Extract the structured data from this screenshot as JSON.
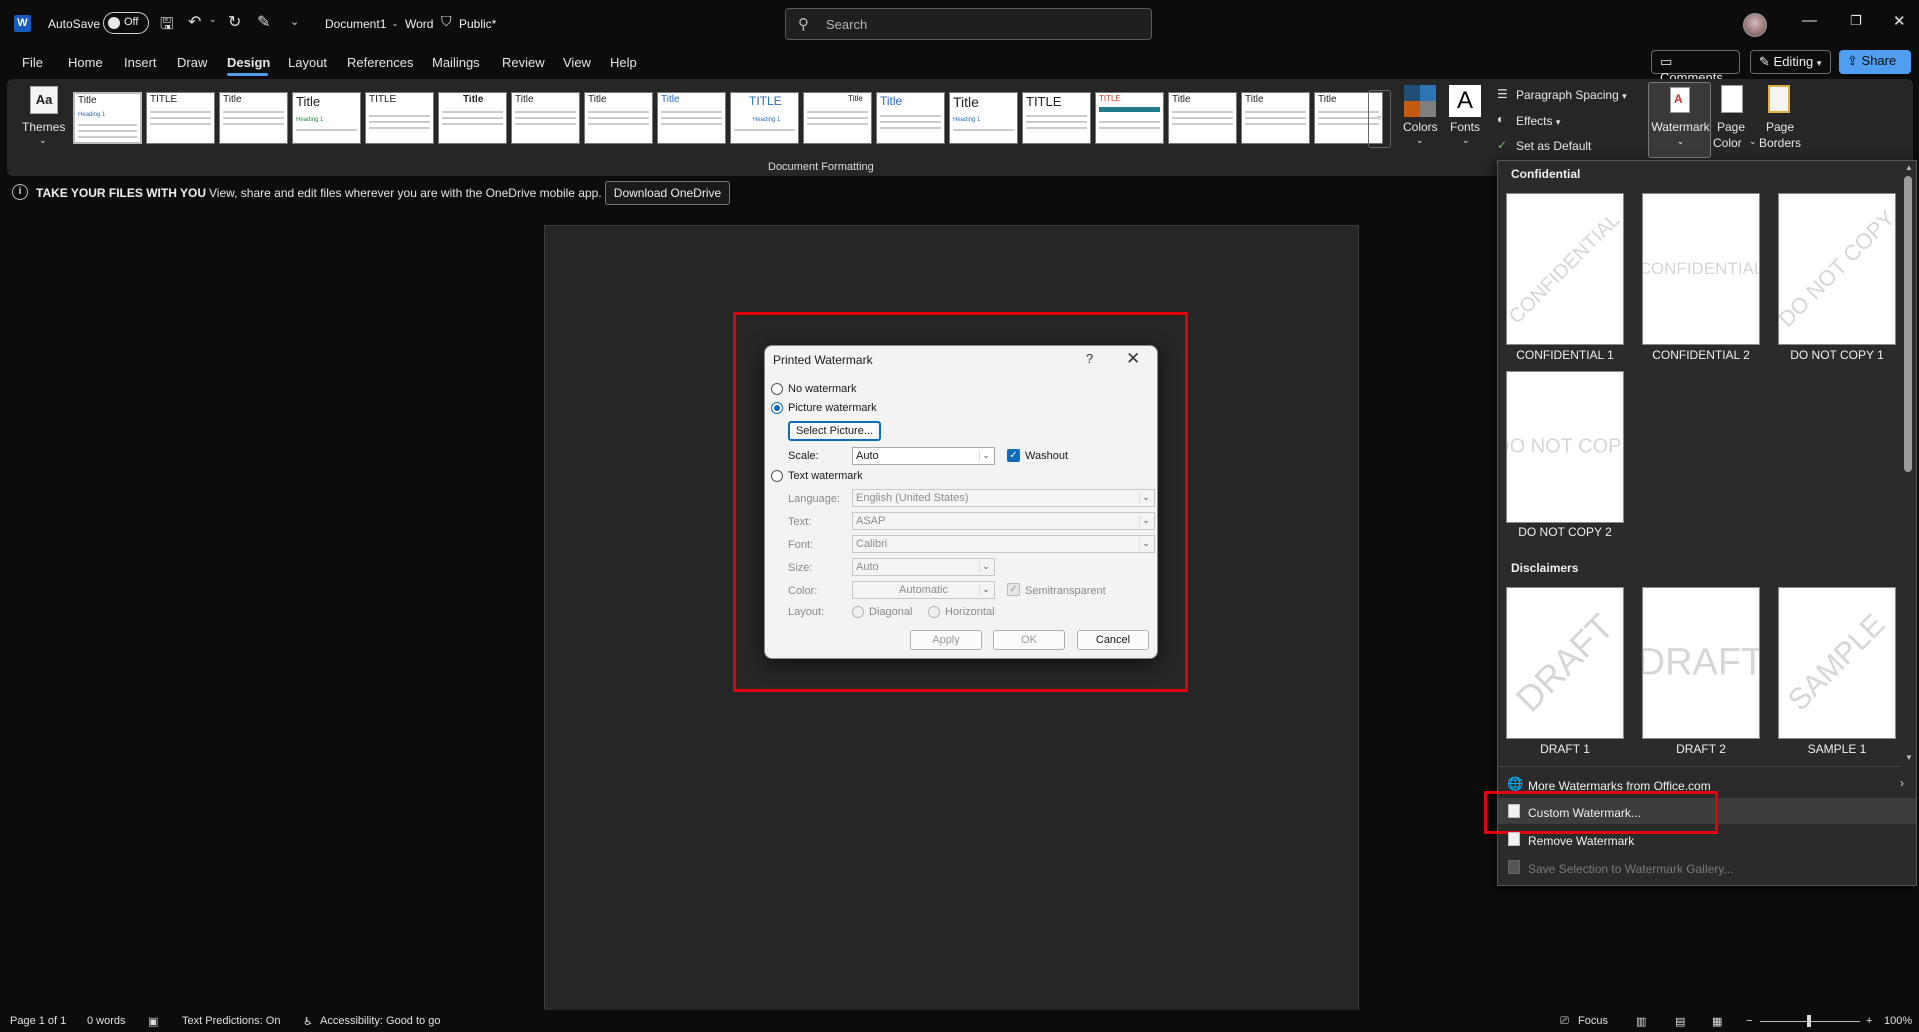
{
  "titlebar": {
    "autosave_label": "AutoSave",
    "autosave_state": "Off",
    "doc_title": "Document1",
    "separator": "-",
    "app_name": "Word",
    "sensitivity": "Public*",
    "search_placeholder": "Search"
  },
  "tabs": [
    {
      "label": "File"
    },
    {
      "label": "Home"
    },
    {
      "label": "Insert"
    },
    {
      "label": "Draw"
    },
    {
      "label": "Design"
    },
    {
      "label": "Layout"
    },
    {
      "label": "References"
    },
    {
      "label": "Mailings"
    },
    {
      "label": "Review"
    },
    {
      "label": "View"
    },
    {
      "label": "Help"
    }
  ],
  "top_actions": {
    "comments": "Comments",
    "editing": "Editing",
    "share": "Share"
  },
  "ribbon": {
    "themes": "Themes",
    "colors": "Colors",
    "fonts": "Fonts",
    "paragraph_spacing": "Paragraph Spacing",
    "effects": "Effects",
    "set_default": "Set as Default",
    "watermark": "Watermark",
    "page_color_1": "Page",
    "page_color_2": "Color",
    "page_borders_1": "Page",
    "page_borders_2": "Borders",
    "group_label": "Document Formatting",
    "gallery": [
      "Title",
      "TITLE",
      "Title",
      "Title",
      "TITLE",
      "Title",
      "Title",
      "Title",
      "Title",
      "TITLE",
      "Title",
      "Title",
      "Title",
      "TITLE",
      "TITLE",
      "Title",
      "Title",
      "Title"
    ]
  },
  "infobar": {
    "heading": "TAKE YOUR FILES WITH YOU",
    "message": "View, share and edit files wherever you are with the OneDrive mobile app.",
    "button": "Download OneDrive"
  },
  "dialog": {
    "title": "Printed Watermark",
    "help": "?",
    "close": "✕",
    "no_watermark": "No watermark",
    "picture_watermark": "Picture watermark",
    "select_picture": "Select Picture...",
    "scale_label": "Scale:",
    "scale_value": "Auto",
    "washout": "Washout",
    "text_watermark": "Text watermark",
    "language_label": "Language:",
    "language_value": "English (United States)",
    "text_label": "Text:",
    "text_value": "ASAP",
    "font_label": "Font:",
    "font_value": "Calibri",
    "size_label": "Size:",
    "size_value": "Auto",
    "color_label": "Color:",
    "color_value": "Automatic",
    "semitransparent": "Semitransparent",
    "layout_label": "Layout:",
    "diagonal": "Diagonal",
    "horizontal": "Horizontal",
    "apply": "Apply",
    "ok": "OK",
    "cancel": "Cancel"
  },
  "watermark_menu": {
    "section_confidential": "Confidential",
    "section_disclaimers": "Disclaimers",
    "items_confidential": [
      {
        "caption": "CONFIDENTIAL 1",
        "text": "CONFIDENTIAL"
      },
      {
        "caption": "CONFIDENTIAL 2",
        "text": "CONFIDENTIAL"
      },
      {
        "caption": "DO NOT COPY 1",
        "text": "DO NOT COPY"
      },
      {
        "caption": "DO NOT COPY 2",
        "text": "DO NOT COPY"
      }
    ],
    "items_disclaimers": [
      {
        "caption": "DRAFT 1",
        "text": "DRAFT"
      },
      {
        "caption": "DRAFT 2",
        "text": "DRAFT"
      },
      {
        "caption": "SAMPLE 1",
        "text": "SAMPLE"
      }
    ],
    "more": "More Watermarks from Office.com",
    "custom": "Custom Watermark...",
    "remove": "Remove Watermark",
    "save": "Save Selection to Watermark Gallery..."
  },
  "statusbar": {
    "page": "Page 1 of 1",
    "words": "0 words",
    "text_predictions": "Text Predictions: On",
    "accessibility": "Accessibility: Good to go",
    "focus": "Focus",
    "zoom": "100%"
  },
  "colors": {
    "accent": "#4f9ef0",
    "highlight_red": "#e1000b",
    "dialog_blue": "#0f6cbd"
  }
}
